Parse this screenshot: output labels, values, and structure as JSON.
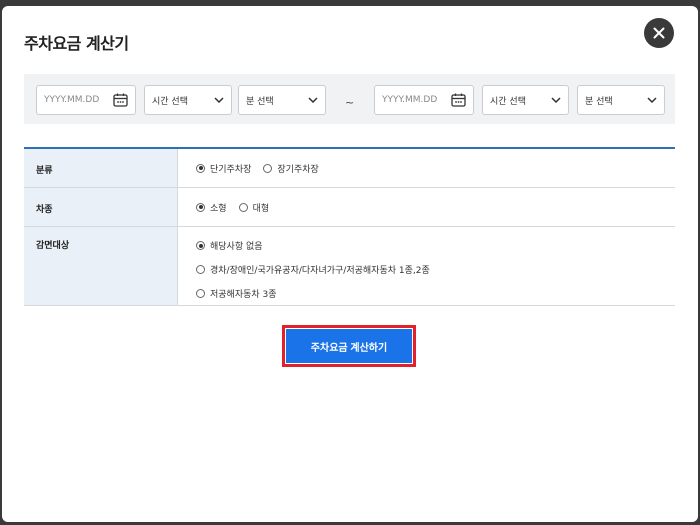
{
  "modal": {
    "title": "주차요금 계산기"
  },
  "filters": {
    "start": {
      "date_placeholder": "YYYY.MM.DD",
      "hour_value": "시간 선택",
      "minute_value": "분 선택"
    },
    "separator": "~",
    "end": {
      "date_placeholder": "YYYY.MM.DD",
      "hour_value": "시간 선택",
      "minute_value": "분 선택"
    }
  },
  "form": {
    "category": {
      "label": "분류",
      "options": [
        {
          "label": "단기주차장",
          "selected": true
        },
        {
          "label": "장기주차장",
          "selected": false
        }
      ]
    },
    "vehicle": {
      "label": "차종",
      "options": [
        {
          "label": "소형",
          "selected": true
        },
        {
          "label": "대형",
          "selected": false
        }
      ]
    },
    "discount": {
      "label": "감면대상",
      "options": [
        {
          "label": "해당사항 없음",
          "selected": true
        },
        {
          "label": "경차/장애인/국가유공자/다자녀가구/저공해자동차 1종,2종",
          "selected": false
        },
        {
          "label": "저공해자동차 3종",
          "selected": false
        }
      ]
    }
  },
  "actions": {
    "calculate_label": "주차요금 계산하기"
  },
  "colors": {
    "primary": "#1a73e8",
    "highlight": "#e3212d",
    "table_border": "#2f6fb4",
    "header_bg": "#eaf0f8"
  }
}
